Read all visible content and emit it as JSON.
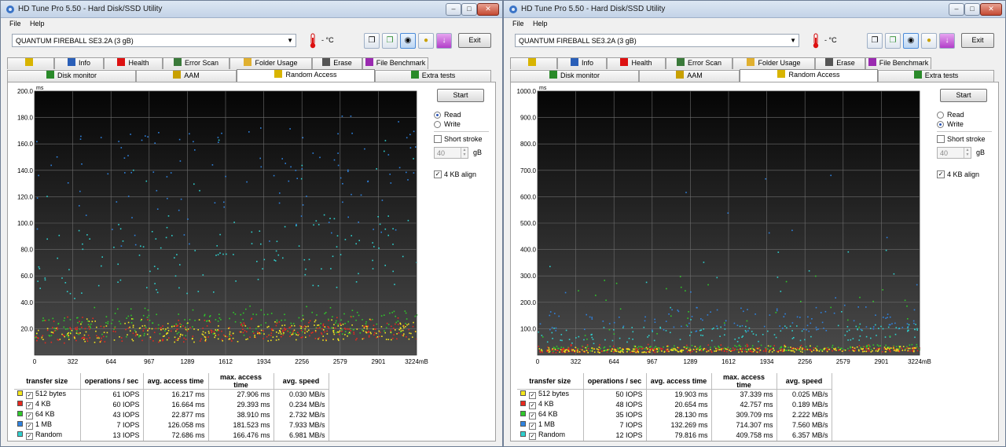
{
  "common": {
    "title": "HD Tune Pro 5.50 - Hard Disk/SSD Utility",
    "menu": [
      "File",
      "Help"
    ],
    "drive": "QUANTUM FIREBALL SE3.2A (3 gB)",
    "temperature": "- °C",
    "exit_label": "Exit",
    "start_label": "Start",
    "read_label": "Read",
    "write_label": "Write",
    "short_stroke_label": "Short stroke",
    "stroke_value": "40",
    "stroke_unit": "gB",
    "align_label": "4 KB align",
    "tabs_row1": [
      {
        "label": "Benchmark",
        "icon": "benchmark-icon"
      },
      {
        "label": "Info",
        "icon": "info-icon"
      },
      {
        "label": "Health",
        "icon": "health-icon"
      },
      {
        "label": "Error Scan",
        "icon": "error-scan-icon"
      },
      {
        "label": "Folder Usage",
        "icon": "folder-icon"
      },
      {
        "label": "Erase",
        "icon": "erase-icon"
      },
      {
        "label": "File Benchmark",
        "icon": "file-benchmark-icon"
      }
    ],
    "tabs_row2": [
      {
        "label": "Disk monitor",
        "icon": "disk-monitor-icon"
      },
      {
        "label": "AAM",
        "icon": "aam-icon"
      },
      {
        "label": "Random Access",
        "icon": "random-access-icon"
      },
      {
        "label": "Extra tests",
        "icon": "extra-tests-icon"
      }
    ],
    "table_headers": [
      "transfer size",
      "operations / sec",
      "avg. access time",
      "max. access time",
      "avg. speed"
    ],
    "series_colors": {
      "512 bytes": "#f5e71c",
      "4 KB": "#e8281e",
      "64 KB": "#2fc92a",
      "1 MB": "#2f83e0",
      "Random": "#2fd1cf"
    }
  },
  "windows": [
    {
      "mode": "read",
      "chart_data": {
        "type": "scatter",
        "ylabel": "ms",
        "xunit": "mB",
        "ylim": [
          0,
          200
        ],
        "y_ticks": [
          "200.0",
          "180.0",
          "160.0",
          "140.0",
          "120.0",
          "100.0",
          "80.0",
          "60.0",
          "40.0",
          "20.0"
        ],
        "x_ticks": [
          "0",
          "322",
          "644",
          "967",
          "1289",
          "1612",
          "1934",
          "2256",
          "2579",
          "2901",
          "3224mB"
        ],
        "series": [
          {
            "name": "512 bytes",
            "avg_ms": 16.2,
            "max_ms": 27.9
          },
          {
            "name": "4 KB",
            "avg_ms": 16.7,
            "max_ms": 29.4
          },
          {
            "name": "64 KB",
            "avg_ms": 22.9,
            "max_ms": 38.9
          },
          {
            "name": "1 MB",
            "avg_ms": 126.1,
            "max_ms": 181.5
          },
          {
            "name": "Random",
            "avg_ms": 72.7,
            "max_ms": 166.5
          }
        ]
      },
      "rows": [
        {
          "size": "512 bytes",
          "ops": "61 IOPS",
          "avg": "16.217 ms",
          "max": "27.906 ms",
          "speed": "0.030 MB/s"
        },
        {
          "size": "4 KB",
          "ops": "60 IOPS",
          "avg": "16.664 ms",
          "max": "29.393 ms",
          "speed": "0.234 MB/s"
        },
        {
          "size": "64 KB",
          "ops": "43 IOPS",
          "avg": "22.877 ms",
          "max": "38.910 ms",
          "speed": "2.732 MB/s"
        },
        {
          "size": "1 MB",
          "ops": "7 IOPS",
          "avg": "126.058 ms",
          "max": "181.523 ms",
          "speed": "7.933 MB/s"
        },
        {
          "size": "Random",
          "ops": "13 IOPS",
          "avg": "72.686 ms",
          "max": "166.476 ms",
          "speed": "6.981 MB/s"
        }
      ]
    },
    {
      "mode": "write",
      "chart_data": {
        "type": "scatter",
        "ylabel": "ms",
        "xunit": "mB",
        "ylim": [
          0,
          1000
        ],
        "y_ticks": [
          "1000.0",
          "900.0",
          "800.0",
          "700.0",
          "600.0",
          "500.0",
          "400.0",
          "300.0",
          "200.0",
          "100.0"
        ],
        "x_ticks": [
          "0",
          "322",
          "644",
          "967",
          "1289",
          "1612",
          "1934",
          "2256",
          "2579",
          "2901",
          "3224mB"
        ],
        "series": [
          {
            "name": "512 bytes",
            "avg_ms": 19.9,
            "max_ms": 37.3
          },
          {
            "name": "4 KB",
            "avg_ms": 20.7,
            "max_ms": 42.8
          },
          {
            "name": "64 KB",
            "avg_ms": 28.1,
            "max_ms": 309.7
          },
          {
            "name": "1 MB",
            "avg_ms": 132.3,
            "max_ms": 714.3
          },
          {
            "name": "Random",
            "avg_ms": 79.8,
            "max_ms": 409.8
          }
        ]
      },
      "rows": [
        {
          "size": "512 bytes",
          "ops": "50 IOPS",
          "avg": "19.903 ms",
          "max": "37.339 ms",
          "speed": "0.025 MB/s"
        },
        {
          "size": "4 KB",
          "ops": "48 IOPS",
          "avg": "20.654 ms",
          "max": "42.757 ms",
          "speed": "0.189 MB/s"
        },
        {
          "size": "64 KB",
          "ops": "35 IOPS",
          "avg": "28.130 ms",
          "max": "309.709 ms",
          "speed": "2.222 MB/s"
        },
        {
          "size": "1 MB",
          "ops": "7 IOPS",
          "avg": "132.269 ms",
          "max": "714.307 ms",
          "speed": "7.560 MB/s"
        },
        {
          "size": "Random",
          "ops": "12 IOPS",
          "avg": "79.816 ms",
          "max": "409.758 ms",
          "speed": "6.357 MB/s"
        }
      ]
    }
  ]
}
